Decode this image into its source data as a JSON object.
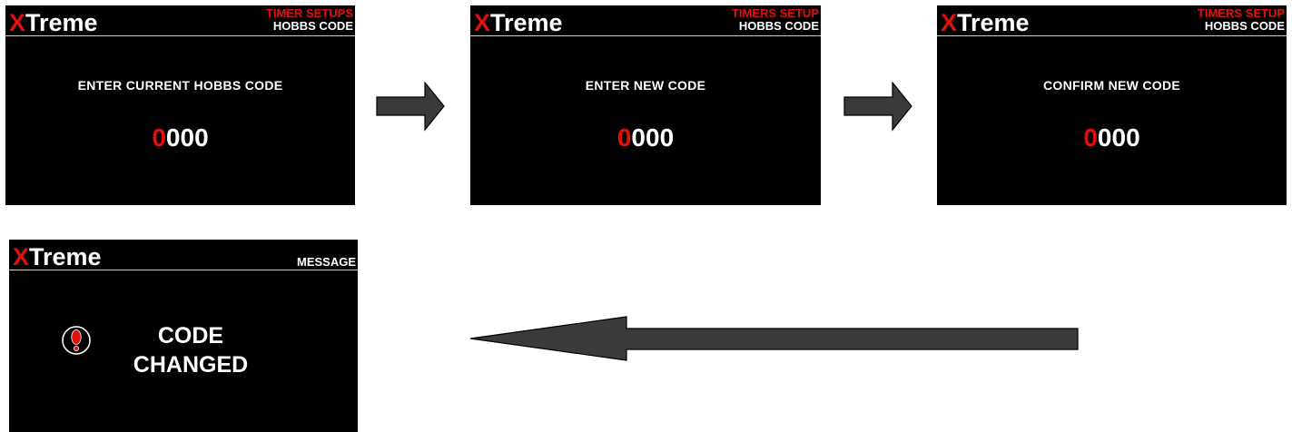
{
  "brand": {
    "x_letter": "X",
    "rest": "Treme"
  },
  "screens": [
    {
      "header_top": "TIMER SETUPS",
      "header_bottom": "HOBBS CODE",
      "prompt": "ENTER CURRENT HOBBS CODE",
      "code_first": "0",
      "code_rest": "000"
    },
    {
      "header_top": "TIMERS SETUP",
      "header_bottom": "HOBBS CODE",
      "prompt": "ENTER NEW CODE",
      "code_first": "0",
      "code_rest": "000"
    },
    {
      "header_top": "TIMERS SETUP",
      "header_bottom": "HOBBS CODE",
      "prompt": "CONFIRM NEW CODE",
      "code_first": "0",
      "code_rest": "000"
    }
  ],
  "message_screen": {
    "header": "MESSAGE",
    "line1": "CODE",
    "line2": "CHANGED",
    "icon": "alert-exclamation-icon"
  },
  "colors": {
    "accent": "#e01010",
    "screen_bg": "#000000",
    "arrow_fill": "#3a3a3a"
  }
}
